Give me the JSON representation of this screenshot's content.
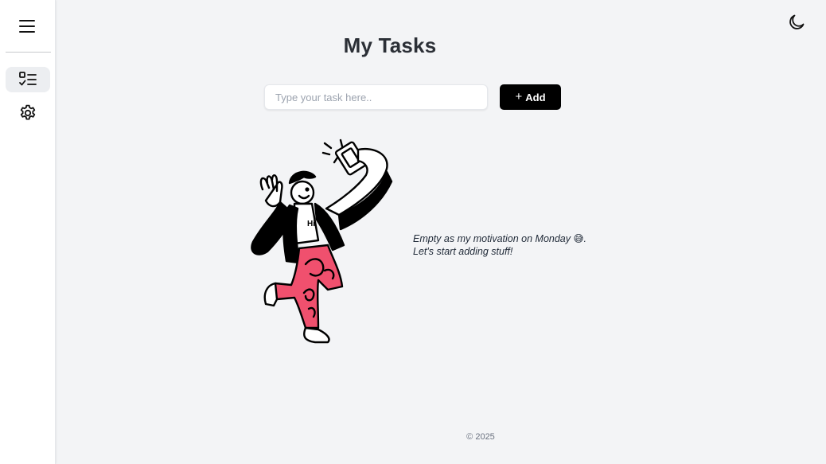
{
  "sidebar": {
    "menu_icon": "hamburger-menu-icon",
    "items": [
      {
        "label": "Tasks",
        "icon": "task-list-icon",
        "active": true
      },
      {
        "label": "Settings",
        "icon": "gear-icon",
        "active": false
      }
    ]
  },
  "header": {
    "theme_toggle_icon": "moon-icon"
  },
  "main": {
    "title": "My Tasks",
    "input_placeholder": "Type your task here..",
    "input_value": "",
    "add_button_label": "Add",
    "add_button_icon": "plus-icon",
    "empty_state": {
      "illustration": "person-taking-selfie-illustration",
      "line1": "Empty as my motivation on Monday 😅.",
      "line2": "Let's start adding stuff!"
    }
  },
  "footer": {
    "text": "© 2025"
  },
  "colors": {
    "background": "#f3f4f6",
    "sidebar": "#ffffff",
    "accent_button": "#000000",
    "illustration_pants": "#f0506e"
  }
}
